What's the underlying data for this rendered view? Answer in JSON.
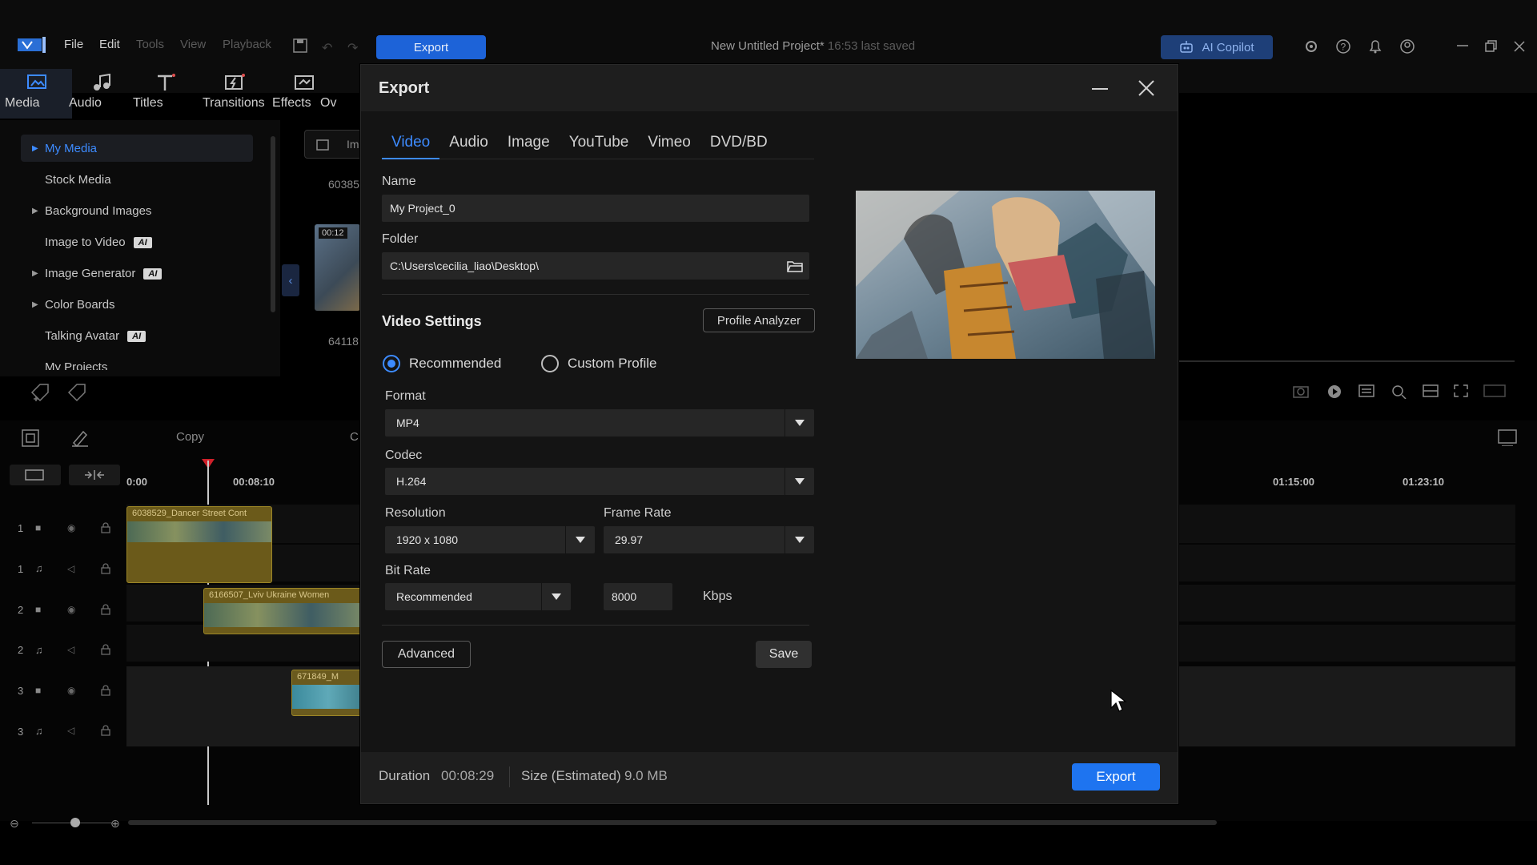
{
  "app": {
    "menu": [
      "File",
      "Edit",
      "Tools",
      "View",
      "Playback"
    ],
    "export_button": "Export",
    "project_title": "New Untitled Project*",
    "save_status": "16:53 last saved",
    "ai_copilot": "AI Copilot",
    "tool_tabs": [
      "Media",
      "Audio",
      "Titles",
      "Transitions",
      "Effects",
      "Ov"
    ],
    "sidebar": {
      "items": [
        {
          "label": "My Media"
        },
        {
          "label": "Stock Media"
        },
        {
          "label": "Background Images"
        },
        {
          "label": "Image to Video",
          "badge": "AI"
        },
        {
          "label": "Image Generator",
          "badge": "AI"
        },
        {
          "label": "Color Boards"
        },
        {
          "label": "Talking Avatar",
          "badge": "AI"
        },
        {
          "label": "My Projects"
        }
      ]
    },
    "media_chips": [
      "Im",
      "60385",
      "00:12",
      "64118"
    ],
    "timeline": {
      "copy_label": "Copy",
      "ruler": [
        "0:00",
        "00:08:10",
        "01:15:00",
        "01:23:10"
      ],
      "track_numbers": [
        "1",
        "1",
        "2",
        "2",
        "3",
        "3"
      ],
      "clips": [
        "6038529_Dancer Street Cont",
        "6166507_Lviv Ukraine Women",
        "671849_M"
      ]
    }
  },
  "dialog": {
    "title": "Export",
    "tabs": [
      "Video",
      "Audio",
      "Image",
      "YouTube",
      "Vimeo",
      "DVD/BD"
    ],
    "active_tab": "Video",
    "name_label": "Name",
    "name_value": "My Project_0",
    "folder_label": "Folder",
    "folder_value": "C:\\Users\\cecilia_liao\\Desktop\\",
    "video_settings_title": "Video Settings",
    "profile_analyzer": "Profile Analyzer",
    "radio_recommended": "Recommended",
    "radio_custom": "Custom Profile",
    "format_label": "Format",
    "format_value": "MP4",
    "codec_label": "Codec",
    "codec_value": "H.264",
    "resolution_label": "Resolution",
    "resolution_value": "1920 x 1080",
    "framerate_label": "Frame Rate",
    "framerate_value": "29.97",
    "bitrate_label": "Bit Rate",
    "bitrate_mode": "Recommended",
    "bitrate_value": "8000",
    "bitrate_unit": "Kbps",
    "advanced": "Advanced",
    "save": "Save",
    "duration_label": "Duration",
    "duration_value": "00:08:29",
    "size_label": "Size (Estimated)",
    "size_value": "9.0 MB",
    "export": "Export"
  },
  "colors": {
    "accent": "#3d8bff",
    "export_bg": "#1e74f0",
    "clip": "#6b5a1a"
  }
}
